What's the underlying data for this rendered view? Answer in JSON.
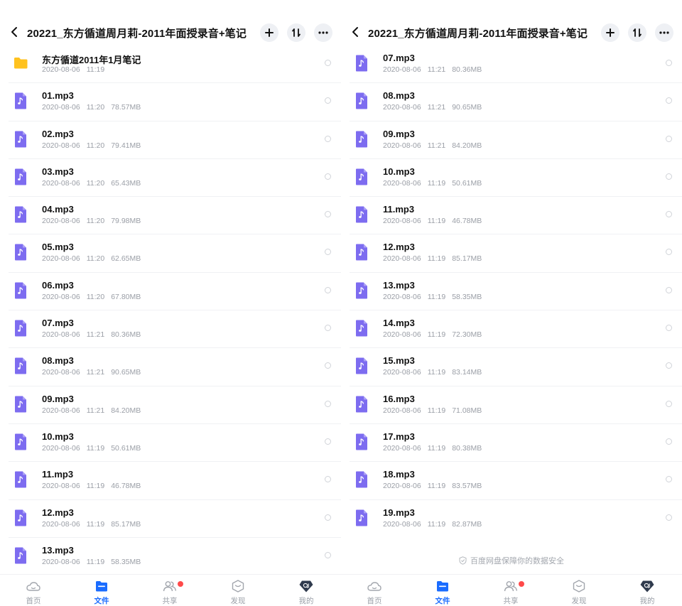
{
  "colors": {
    "accent": "#1a6cff",
    "audio_icon": "#7d6cf0",
    "folder_icon": "#ffc21f",
    "badge": "#ff4a4a"
  },
  "icons": {
    "folder": "folder-icon",
    "audio": "music-file-icon",
    "back": "chevron-left-icon",
    "add": "plus-icon",
    "sort": "sort-icon",
    "more": "more-dots-icon"
  },
  "left": {
    "header": {
      "title": "20221_东方循道周月莉-2011年面授录音+笔记"
    },
    "files": [
      {
        "type": "folder",
        "name": "东方循道2011年1月笔记",
        "date": "2020-08-06",
        "time": "11:19",
        "size": ""
      },
      {
        "type": "audio",
        "name": "01.mp3",
        "date": "2020-08-06",
        "time": "11:20",
        "size": "78.57MB"
      },
      {
        "type": "audio",
        "name": "02.mp3",
        "date": "2020-08-06",
        "time": "11:20",
        "size": "79.41MB"
      },
      {
        "type": "audio",
        "name": "03.mp3",
        "date": "2020-08-06",
        "time": "11:20",
        "size": "65.43MB"
      },
      {
        "type": "audio",
        "name": "04.mp3",
        "date": "2020-08-06",
        "time": "11:20",
        "size": "79.98MB"
      },
      {
        "type": "audio",
        "name": "05.mp3",
        "date": "2020-08-06",
        "time": "11:20",
        "size": "62.65MB"
      },
      {
        "type": "audio",
        "name": "06.mp3",
        "date": "2020-08-06",
        "time": "11:20",
        "size": "67.80MB"
      },
      {
        "type": "audio",
        "name": "07.mp3",
        "date": "2020-08-06",
        "time": "11:21",
        "size": "80.36MB"
      },
      {
        "type": "audio",
        "name": "08.mp3",
        "date": "2020-08-06",
        "time": "11:21",
        "size": "90.65MB"
      },
      {
        "type": "audio",
        "name": "09.mp3",
        "date": "2020-08-06",
        "time": "11:21",
        "size": "84.20MB"
      },
      {
        "type": "audio",
        "name": "10.mp3",
        "date": "2020-08-06",
        "time": "11:19",
        "size": "50.61MB"
      },
      {
        "type": "audio",
        "name": "11.mp3",
        "date": "2020-08-06",
        "time": "11:19",
        "size": "46.78MB"
      },
      {
        "type": "audio",
        "name": "12.mp3",
        "date": "2020-08-06",
        "time": "11:19",
        "size": "85.17MB"
      },
      {
        "type": "audio",
        "name": "13.mp3",
        "date": "2020-08-06",
        "time": "11:19",
        "size": "58.35MB"
      }
    ],
    "tabs": [
      {
        "label": "首页",
        "icon": "cloud-home-icon",
        "active": false
      },
      {
        "label": "文件",
        "icon": "folder-tab-icon",
        "active": true
      },
      {
        "label": "共享",
        "icon": "share-people-icon",
        "active": false
      },
      {
        "label": "发现",
        "icon": "discover-box-icon",
        "active": false
      },
      {
        "label": "我的",
        "icon": "profile-avatar-icon",
        "active": false
      }
    ]
  },
  "right": {
    "header": {
      "title": "20221_东方循道周月莉-2011年面授录音+笔记"
    },
    "files": [
      {
        "type": "audio",
        "name": "07.mp3",
        "date": "2020-08-06",
        "time": "11:21",
        "size": "80.36MB"
      },
      {
        "type": "audio",
        "name": "08.mp3",
        "date": "2020-08-06",
        "time": "11:21",
        "size": "90.65MB"
      },
      {
        "type": "audio",
        "name": "09.mp3",
        "date": "2020-08-06",
        "time": "11:21",
        "size": "84.20MB"
      },
      {
        "type": "audio",
        "name": "10.mp3",
        "date": "2020-08-06",
        "time": "11:19",
        "size": "50.61MB"
      },
      {
        "type": "audio",
        "name": "11.mp3",
        "date": "2020-08-06",
        "time": "11:19",
        "size": "46.78MB"
      },
      {
        "type": "audio",
        "name": "12.mp3",
        "date": "2020-08-06",
        "time": "11:19",
        "size": "85.17MB"
      },
      {
        "type": "audio",
        "name": "13.mp3",
        "date": "2020-08-06",
        "time": "11:19",
        "size": "58.35MB"
      },
      {
        "type": "audio",
        "name": "14.mp3",
        "date": "2020-08-06",
        "time": "11:19",
        "size": "72.30MB"
      },
      {
        "type": "audio",
        "name": "15.mp3",
        "date": "2020-08-06",
        "time": "11:19",
        "size": "83.14MB"
      },
      {
        "type": "audio",
        "name": "16.mp3",
        "date": "2020-08-06",
        "time": "11:19",
        "size": "71.08MB"
      },
      {
        "type": "audio",
        "name": "17.mp3",
        "date": "2020-08-06",
        "time": "11:19",
        "size": "80.38MB"
      },
      {
        "type": "audio",
        "name": "18.mp3",
        "date": "2020-08-06",
        "time": "11:19",
        "size": "83.57MB"
      },
      {
        "type": "audio",
        "name": "19.mp3",
        "date": "2020-08-06",
        "time": "11:19",
        "size": "82.87MB"
      }
    ],
    "secure_note": "百度网盘保障你的数据安全",
    "tabs": [
      {
        "label": "首页",
        "icon": "cloud-home-icon",
        "active": false
      },
      {
        "label": "文件",
        "icon": "folder-tab-icon",
        "active": true
      },
      {
        "label": "共享",
        "icon": "share-people-icon",
        "active": false
      },
      {
        "label": "发现",
        "icon": "discover-box-icon",
        "active": false
      },
      {
        "label": "我的",
        "icon": "profile-avatar-icon",
        "active": false
      }
    ]
  }
}
